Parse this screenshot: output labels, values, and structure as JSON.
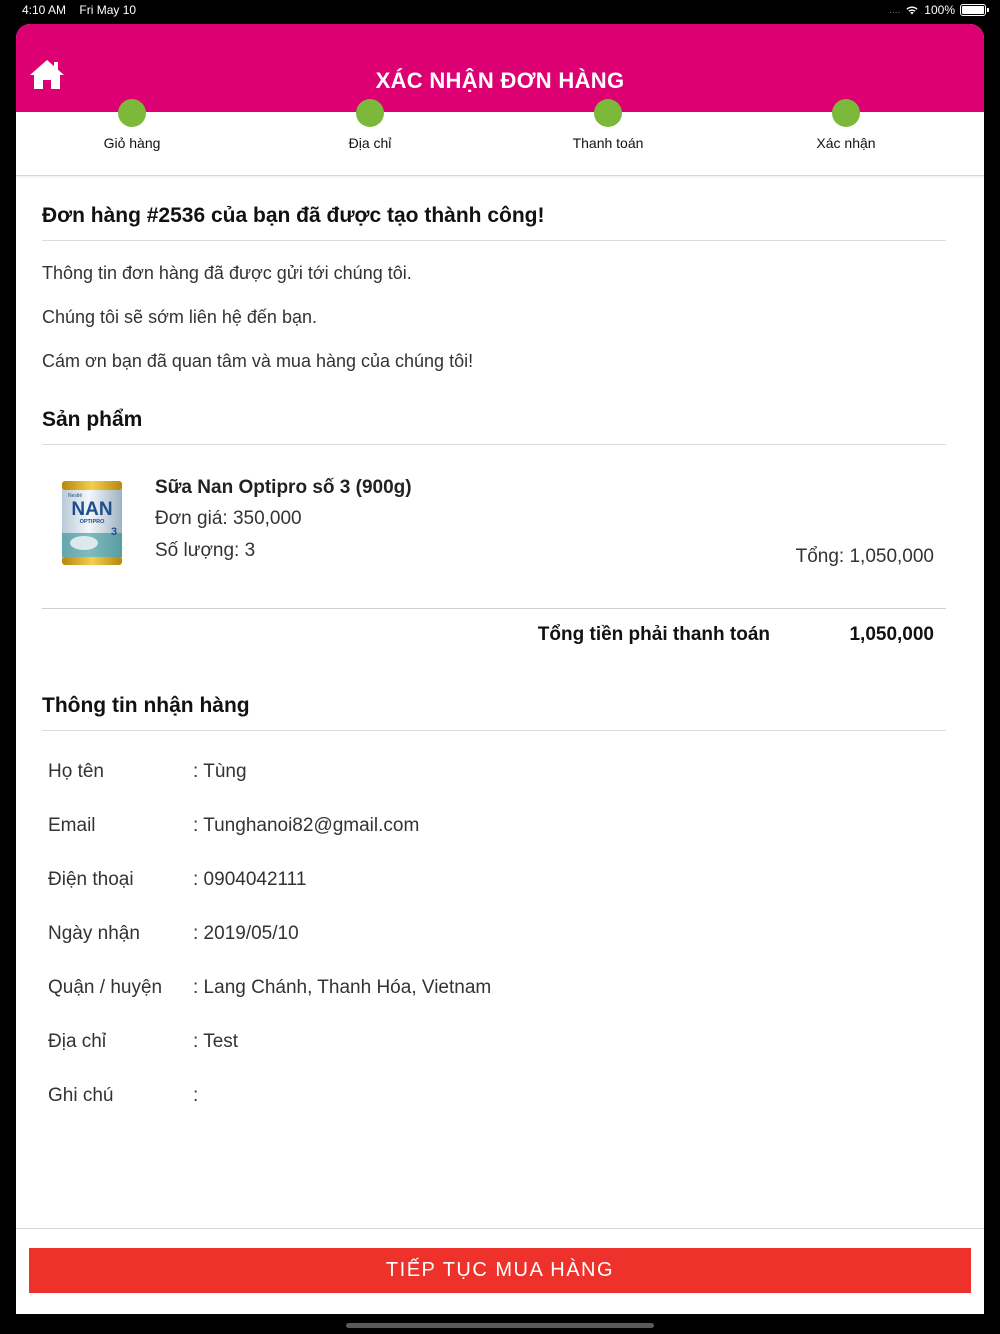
{
  "status_bar": {
    "time": "4:10 AM",
    "date": "Fri May 10",
    "battery": "100%",
    "signal_dots": "...."
  },
  "header": {
    "title": "XÁC NHẬN ĐƠN HÀNG",
    "home_icon": "home-icon"
  },
  "stepper": {
    "steps": [
      {
        "label": "Giỏ hàng"
      },
      {
        "label": "Địa chỉ"
      },
      {
        "label": "Thanh toán"
      },
      {
        "label": "Xác nhận"
      }
    ],
    "active_color": "#7cb83a"
  },
  "order": {
    "success_title": "Đơn hàng #2536 của bạn đã được tạo thành công!",
    "messages": [
      "Thông tin đơn hàng đã được gửi tới chúng tôi.",
      "Chúng tôi sẽ sớm liên hệ đến bạn.",
      "Cám ơn bạn đã quan tâm và mua hàng của chúng tôi!"
    ]
  },
  "products": {
    "section_title": "Sản phẩm",
    "items": [
      {
        "name": "Sữa Nan Optipro số 3 (900g)",
        "price": "Đơn giá: 350,000",
        "quantity": "Số lượng: 3",
        "total": "Tổng: 1,050,000",
        "image_brand": "NAN",
        "image_sub": "OPTIPRO",
        "image_maker": "Nestlé",
        "image_number": "3"
      }
    ],
    "grand_total_label": "Tổng tiền phải thanh toán",
    "grand_total_value": "1,050,000"
  },
  "shipping": {
    "section_title": "Thông tin nhận hàng",
    "rows": [
      {
        "label": "Họ tên",
        "value": ": Tùng"
      },
      {
        "label": "Email",
        "value": ": Tunghanoi82@gmail.com"
      },
      {
        "label": "Điện thoại",
        "value": ": 0904042111"
      },
      {
        "label": "Ngày nhận",
        "value": ": 2019/05/10"
      },
      {
        "label": "Quận / huyện",
        "value": ": Lang Chánh, Thanh Hóa, Vietnam"
      },
      {
        "label": "Địa chỉ",
        "value": ": Test"
      },
      {
        "label": "Ghi chú",
        "value": ":"
      }
    ]
  },
  "footer": {
    "continue_label": "TIẾP TỤC MUA HÀNG"
  },
  "colors": {
    "brand": "#dc0073",
    "cta": "#ee312a",
    "step": "#7cb83a"
  }
}
